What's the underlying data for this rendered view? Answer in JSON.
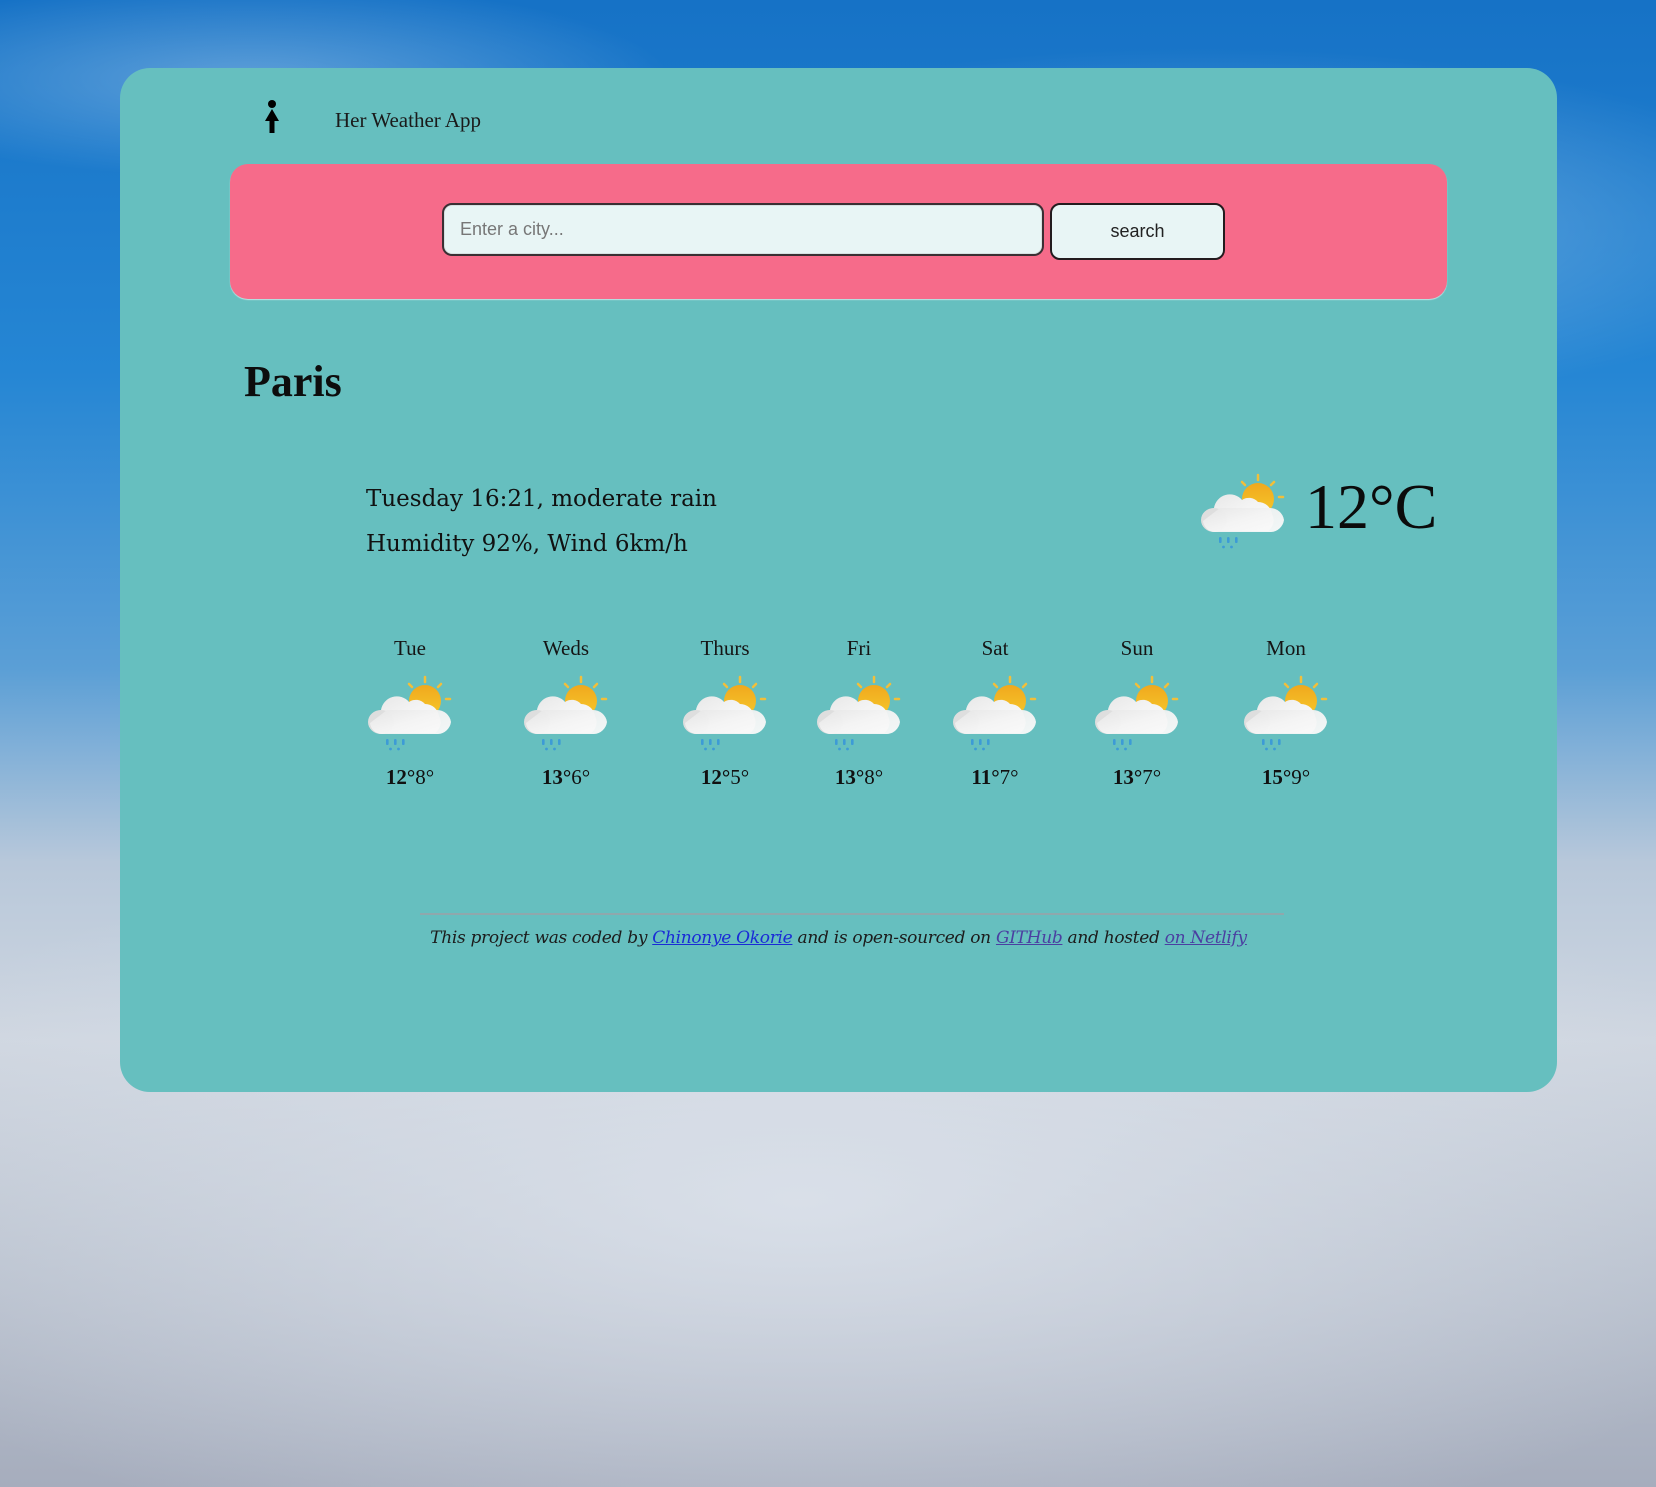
{
  "header": {
    "logo_icon": "woman-figure-icon",
    "app_name": "Her Weather App"
  },
  "search": {
    "placeholder": "Enter a city...",
    "value": "",
    "button_label": "search"
  },
  "current": {
    "city": "Paris",
    "datetime_description": "Tuesday 16:21, moderate rain",
    "humidity_wind": "Humidity 92%, Wind 6km/h",
    "icon": "cloud-sun-rain-icon",
    "temperature": "12°C"
  },
  "forecast": [
    {
      "day": "Tue",
      "max": "12°",
      "min": "8°",
      "icon": "cloud-sun-rain-icon"
    },
    {
      "day": "Weds",
      "max": "13°",
      "min": "6°",
      "icon": "cloud-sun-rain-icon"
    },
    {
      "day": "Thurs",
      "max": "12°",
      "min": "5°",
      "icon": "cloud-sun-rain-icon"
    },
    {
      "day": "Fri",
      "max": "13°",
      "min": "8°",
      "icon": "cloud-sun-rain-icon"
    },
    {
      "day": "Sat",
      "max": "11°",
      "min": "7°",
      "icon": "cloud-sun-rain-icon"
    },
    {
      "day": "Sun",
      "max": "13°",
      "min": "7°",
      "icon": "cloud-sun-rain-icon"
    },
    {
      "day": "Mon",
      "max": "15°",
      "min": "9°",
      "icon": "cloud-sun-rain-icon"
    }
  ],
  "footer": {
    "text_1": "This project was coded by ",
    "author_link": "Chinonye Okorie",
    "text_2": " and is open-sourced on ",
    "github_link": "GITHub",
    "text_3": " and hosted ",
    "netlify_link": "on Netlify"
  },
  "colors": {
    "card_bg": "#66bfbf",
    "search_panel_bg": "#f66b8a",
    "input_bg": "#e8f5f5",
    "link": "#1a2bd6",
    "link_visited": "#4b3fa1"
  }
}
